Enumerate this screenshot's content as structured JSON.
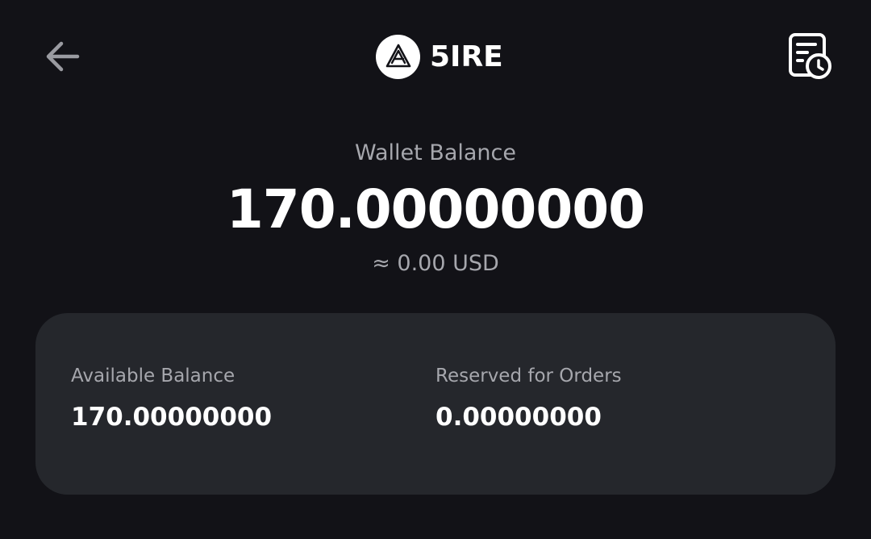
{
  "header": {
    "back_icon": "arrow-left-icon",
    "brand_name": "5IRE",
    "brand_logo_icon": "5ire-logo-icon",
    "history_icon": "document-clock-icon"
  },
  "balance": {
    "label": "Wallet Balance",
    "amount": "170.00000000",
    "fiat": "≈ 0.00 USD"
  },
  "details": {
    "available_label": "Available Balance",
    "available_value": "170.00000000",
    "reserved_label": "Reserved for Orders",
    "reserved_value": "0.00000000"
  },
  "colors": {
    "background": "#121217",
    "card": "#25272c",
    "muted_text": "#a6a7ad",
    "primary_text": "#ffffff"
  }
}
